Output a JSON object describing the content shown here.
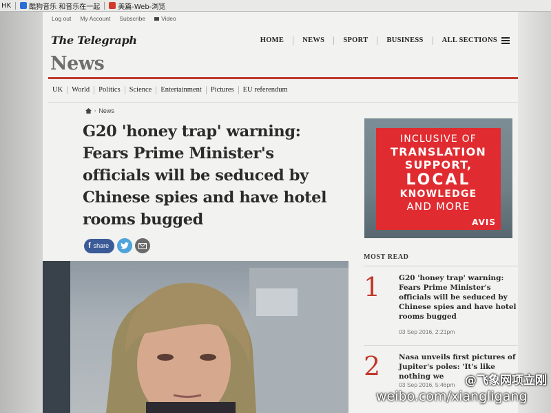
{
  "bookmarks": [
    {
      "label": "HK",
      "color": ""
    },
    {
      "label": "酷狗音乐 和音乐在一起",
      "color": "#2a6fd6"
    },
    {
      "label": "美篇-Web-浏览",
      "color": "#d23a2a"
    }
  ],
  "utility_links": {
    "log_out": "Log out",
    "my_account": "My Account",
    "subscribe": "Subscribe",
    "video": "Video"
  },
  "masthead": "The Telegraph",
  "nav": {
    "home": "HOME",
    "news": "NEWS",
    "sport": "SPORT",
    "business": "BUSINESS",
    "all_sections": "ALL SECTIONS"
  },
  "section_title": "News",
  "subnav": [
    "UK",
    "World",
    "Politics",
    "Science",
    "Entertainment",
    "Pictures",
    "EU referendum"
  ],
  "breadcrumb": {
    "label": "News"
  },
  "article": {
    "headline_lines": [
      "G20 'honey trap' warning:",
      "Fears Prime Minister's",
      "officials will be seduced by",
      "Chinese spies and have hotel",
      "rooms bugged"
    ],
    "share_label": "share"
  },
  "ad": {
    "lines": [
      "INCLUSIVE OF",
      "TRANSLATION",
      "SUPPORT,",
      "LOCAL",
      "KNOWLEDGE",
      "AND MORE"
    ],
    "brand": "AVIS"
  },
  "most_read": {
    "title": "MOST READ",
    "items": [
      {
        "rank": "1",
        "title_lines": [
          "G20 'honey trap' warning:",
          "Fears Prime Minister's",
          "officials will be seduced by",
          "Chinese spies and have hotel",
          "rooms bugged"
        ],
        "time": "03 Sep 2016, 2:21pm"
      },
      {
        "rank": "2",
        "title_lines": [
          "Nasa unveils first pictures of",
          "Jupiter's poles: 'It's like",
          "nothing we"
        ],
        "time": "03 Sep 2016, 5:46pm"
      }
    ]
  },
  "watermark": {
    "handle": "@飞象网项立刚",
    "url": "weibo.com/xiangligang"
  },
  "colors": {
    "accent_red": "#c0382b",
    "facebook": "#3b5a98",
    "twitter": "#4da4db",
    "ad_red": "#e02c31"
  }
}
